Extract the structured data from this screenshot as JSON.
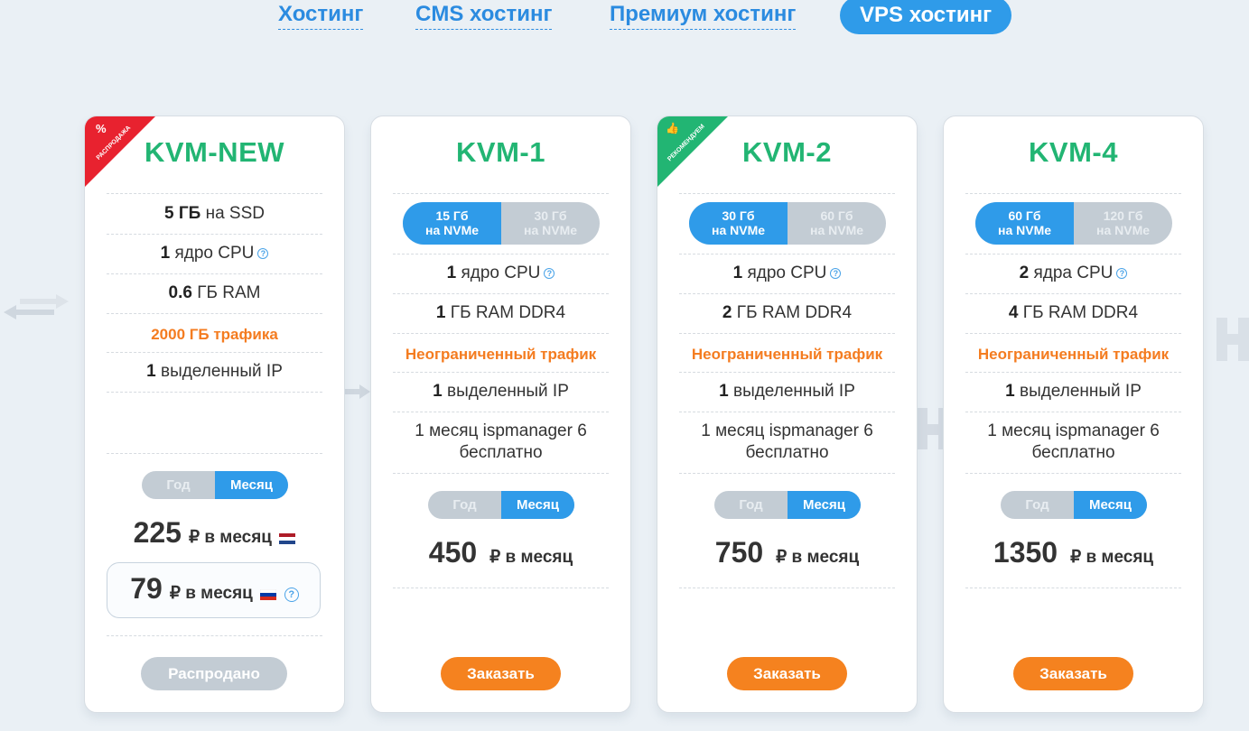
{
  "tabs": [
    "Хостинг",
    "CMS хостинг",
    "Премиум хостинг",
    "VPS хостинг"
  ],
  "help_glyph": "?",
  "period": {
    "year": "Год",
    "month": "Месяц"
  },
  "cards": [
    {
      "title": "KVM-NEW",
      "ribbon": "РАСПРОДАЖА",
      "ribbon_symbol": "%",
      "ribbon_color": "#e8222f",
      "disk_value": "5 ГБ",
      "disk_text": "на SSD",
      "cpu_value": "1",
      "cpu_text": "ядро CPU",
      "ram_value": "0.6",
      "ram_text": "ГБ RAM",
      "traffic": "2000 ГБ трафика",
      "ip_value": "1",
      "ip_text": "выделенный IP",
      "price": "225",
      "price_unit": "₽ в месяц",
      "promo_price": "79",
      "promo_unit": "₽ в месяц",
      "button": "Распродано"
    },
    {
      "title": "KVM-1",
      "seg_on": [
        "15 Гб",
        "на NVMe"
      ],
      "seg_off": [
        "30 Гб",
        "на NVMe"
      ],
      "cpu_value": "1",
      "cpu_text": "ядро CPU",
      "ram_value": "1",
      "ram_text": "ГБ RAM DDR4",
      "traffic": "Неограниченный трафик",
      "ip_value": "1",
      "ip_text": "выделенный IP",
      "isp": [
        "1 месяц ispmanager 6",
        "бесплатно"
      ],
      "price": "450",
      "price_unit": "₽ в месяц",
      "button": "Заказать"
    },
    {
      "title": "KVM-2",
      "ribbon": "РЕКОМЕНДУЕМ",
      "ribbon_symbol": "👍",
      "ribbon_color": "#22b573",
      "seg_on": [
        "30 Гб",
        "на NVMe"
      ],
      "seg_off": [
        "60 Гб",
        "на NVMe"
      ],
      "cpu_value": "1",
      "cpu_text": "ядро CPU",
      "ram_value": "2",
      "ram_text": "ГБ RAM DDR4",
      "traffic": "Неограниченный трафик",
      "ip_value": "1",
      "ip_text": "выделенный IP",
      "isp": [
        "1 месяц ispmanager 6",
        "бесплатно"
      ],
      "price": "750",
      "price_unit": "₽ в месяц",
      "button": "Заказать"
    },
    {
      "title": "KVM-4",
      "seg_on": [
        "60 Гб",
        "на NVMe"
      ],
      "seg_off": [
        "120 Гб",
        "на NVMe"
      ],
      "cpu_value": "2",
      "cpu_text": "ядра CPU",
      "ram_value": "4",
      "ram_text": "ГБ RAM DDR4",
      "traffic": "Неограниченный трафик",
      "ip_value": "1",
      "ip_text": "выделенный IP",
      "isp": [
        "1 месяц ispmanager 6",
        "бесплатно"
      ],
      "price": "1350",
      "price_unit": "₽ в месяц",
      "button": "Заказать"
    }
  ],
  "colors": {
    "accent": "#2f9be9",
    "green": "#22b573",
    "orange": "#f5821f",
    "sale_red": "#e8222f"
  }
}
